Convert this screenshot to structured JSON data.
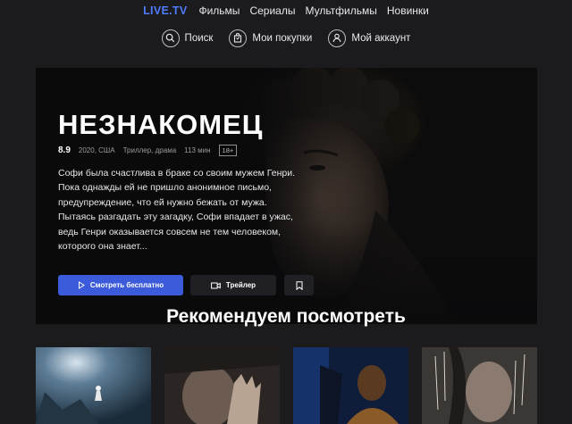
{
  "nav": {
    "logo": "LIVE.TV",
    "links": [
      "Фильмы",
      "Сериалы",
      "Мультфильмы",
      "Новинки"
    ]
  },
  "actions": {
    "search": "Поиск",
    "purchases": "Мои покупки",
    "account": "Мой аккаунт"
  },
  "hero": {
    "title": "НЕЗНАКОМЕЦ",
    "rating": "8.9",
    "year_country": "2020, США",
    "genres": "Триллер, драма",
    "duration": "113 мин",
    "age": "18+",
    "description_lines": [
      "Софи была счастлива в браке со своим мужем Генри.",
      "Пока однажды ей не пришло анонимное письмо,",
      "предупреждение, что ей нужно бежать от мужа.",
      "Пытаясь разгадать эту загадку, Софи впадает в ужас,",
      "ведь Генри оказывается совсем не тем человеком,",
      "которого она знает..."
    ],
    "watch_label": "Смотреть бесплатно",
    "trailer_label": "Трейлер"
  },
  "section": {
    "title": "Рекомендуем посмотреть"
  },
  "colors": {
    "accent": "#3b5bdb",
    "logo": "#4f7cff",
    "background": "#1b1b1d"
  }
}
